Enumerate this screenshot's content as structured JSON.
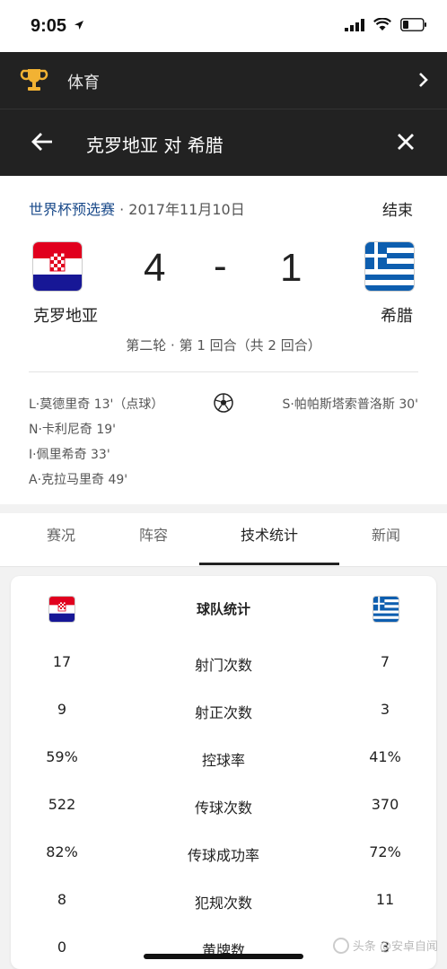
{
  "status_bar": {
    "time": "9:05"
  },
  "header": {
    "category": "体育",
    "title": "克罗地亚 对 希腊"
  },
  "match": {
    "competition": "世界杯预选赛",
    "date": "· 2017年11月10日",
    "status": "结束",
    "home_team": "克罗地亚",
    "away_team": "希腊",
    "home_score": "4",
    "score_separator": "-",
    "away_score": "1",
    "round_info": "第二轮 · 第 1 回合（共 2 回合）",
    "home_scorers": [
      "L·莫德里奇 13'（点球）",
      "N·卡利尼奇 19'",
      "I·佩里希奇 33'",
      "A·克拉马里奇 49'"
    ],
    "away_scorers": [
      "S·帕帕斯塔索普洛斯 30'"
    ]
  },
  "tabs": [
    {
      "label": "赛况"
    },
    {
      "label": "阵容"
    },
    {
      "label": "技术统计"
    },
    {
      "label": "新闻"
    }
  ],
  "stats": {
    "header": "球队统计",
    "rows": [
      {
        "label": "射门次数",
        "home": "17",
        "away": "7"
      },
      {
        "label": "射正次数",
        "home": "9",
        "away": "3"
      },
      {
        "label": "控球率",
        "home": "59%",
        "away": "41%"
      },
      {
        "label": "传球次数",
        "home": "522",
        "away": "370"
      },
      {
        "label": "传球成功率",
        "home": "82%",
        "away": "72%"
      },
      {
        "label": "犯规次数",
        "home": "8",
        "away": "11"
      },
      {
        "label": "黄牌数",
        "home": "0",
        "away": "3"
      }
    ]
  },
  "watermark": "头条 @安卓自闻",
  "colors": {
    "header_bg": "#222222",
    "competition_link": "#1a4a8a",
    "croatia_red": "#e1001e",
    "croatia_blue": "#171796",
    "greece_blue": "#0d5eaf"
  }
}
